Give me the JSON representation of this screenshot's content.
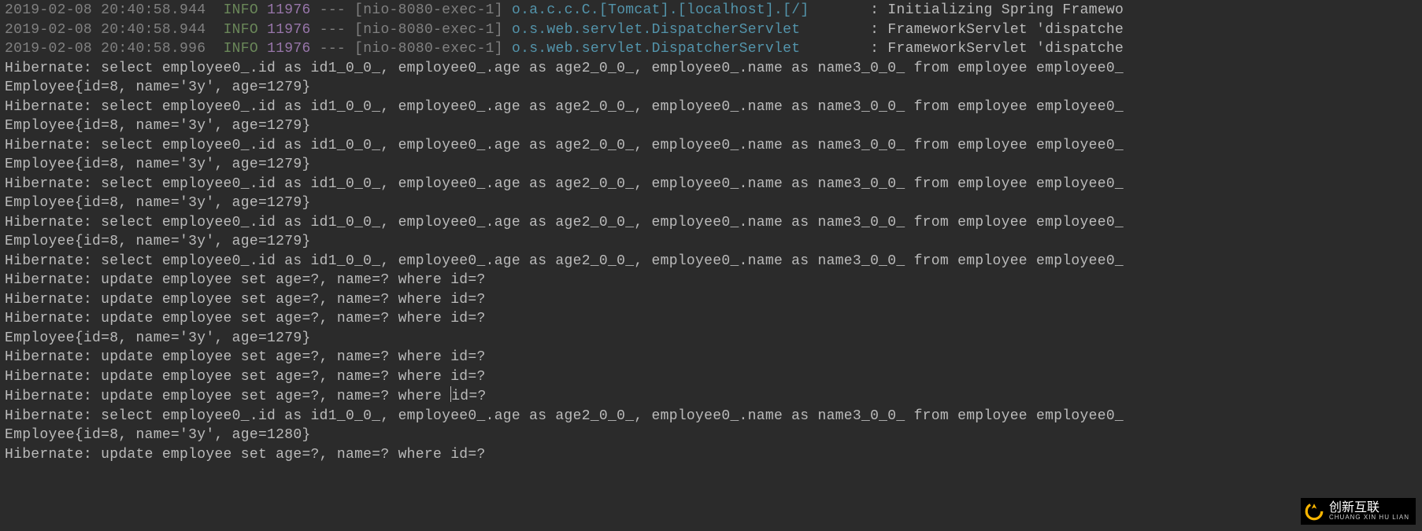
{
  "spring": [
    {
      "ts": "2019-02-08 20:40:58.944",
      "level": "INFO",
      "pid": "11976",
      "dashes": "---",
      "thread": "[nio-8080-exec-1]",
      "logger": "o.a.c.c.C.[Tomcat].[localhost].[/]",
      "colon": ":",
      "msg": "Initializing Spring Framewo"
    },
    {
      "ts": "2019-02-08 20:40:58.944",
      "level": "INFO",
      "pid": "11976",
      "dashes": "---",
      "thread": "[nio-8080-exec-1]",
      "logger": "o.s.web.servlet.DispatcherServlet",
      "colon": ":",
      "msg": "FrameworkServlet 'dispatche"
    },
    {
      "ts": "2019-02-08 20:40:58.996",
      "level": "INFO",
      "pid": "11976",
      "dashes": "---",
      "thread": "[nio-8080-exec-1]",
      "logger": "o.s.web.servlet.DispatcherServlet",
      "colon": ":",
      "msg": "FrameworkServlet 'dispatche"
    }
  ],
  "pad": {
    "logger_width": 40,
    "total_before_msg": 107
  },
  "plain": [
    "Hibernate: select employee0_.id as id1_0_0_, employee0_.age as age2_0_0_, employee0_.name as name3_0_0_ from employee employee0_",
    "Employee{id=8, name='3y', age=1279}",
    "Hibernate: select employee0_.id as id1_0_0_, employee0_.age as age2_0_0_, employee0_.name as name3_0_0_ from employee employee0_",
    "Employee{id=8, name='3y', age=1279}",
    "Hibernate: select employee0_.id as id1_0_0_, employee0_.age as age2_0_0_, employee0_.name as name3_0_0_ from employee employee0_",
    "Employee{id=8, name='3y', age=1279}",
    "Hibernate: select employee0_.id as id1_0_0_, employee0_.age as age2_0_0_, employee0_.name as name3_0_0_ from employee employee0_",
    "Employee{id=8, name='3y', age=1279}",
    "Hibernate: select employee0_.id as id1_0_0_, employee0_.age as age2_0_0_, employee0_.name as name3_0_0_ from employee employee0_",
    "Employee{id=8, name='3y', age=1279}",
    "Hibernate: select employee0_.id as id1_0_0_, employee0_.age as age2_0_0_, employee0_.name as name3_0_0_ from employee employee0_",
    "Hibernate: update employee set age=?, name=? where id=?",
    "Hibernate: update employee set age=?, name=? where id=?",
    "Hibernate: update employee set age=?, name=? where id=?",
    "Employee{id=8, name='3y', age=1279}",
    "Hibernate: update employee set age=?, name=? where id=?",
    "Hibernate: update employee set age=?, name=? where id=?",
    "Hibernate: update employee set age=?, name=? where id=?",
    "Hibernate: select employee0_.id as id1_0_0_, employee0_.age as age2_0_0_, employee0_.name as name3_0_0_ from employee employee0_",
    "Employee{id=8, name='3y', age=1280}",
    "Hibernate: update employee set age=?, name=? where id=?"
  ],
  "caret_line_index": 17,
  "caret_col": 51,
  "watermark": {
    "title": "创新互联",
    "sub": "CHUANG XIN HU LIAN"
  }
}
